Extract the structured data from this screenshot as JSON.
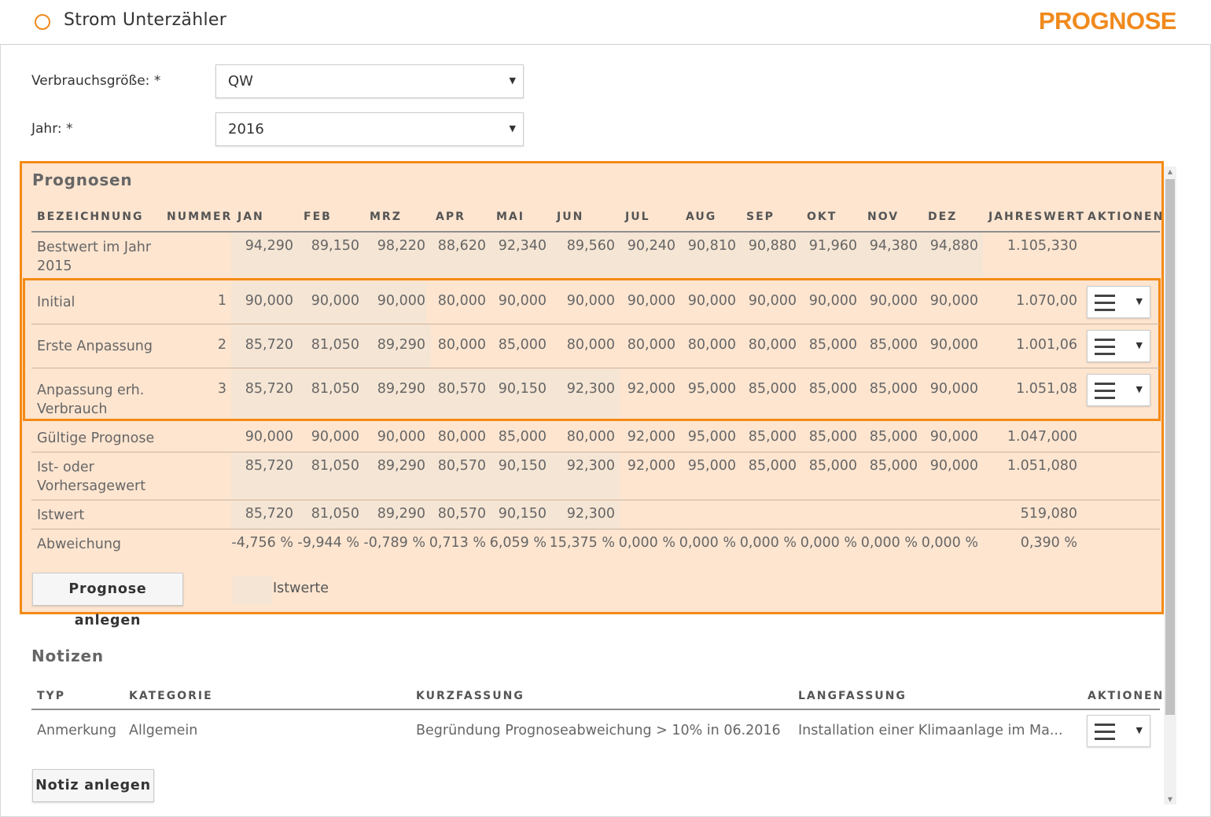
{
  "header": {
    "title": "Strom Unterzähler",
    "brand": "PROGNOSE"
  },
  "form": {
    "verbrauch_label": "Verbrauchsgröße: *",
    "verbrauch_value": "QW",
    "jahr_label": "Jahr: *",
    "jahr_value": "2016"
  },
  "prognosen": {
    "title": "Prognosen",
    "headers": [
      "BEZEICHNUNG",
      "NUMMER",
      "JAN",
      "FEB",
      "MRZ",
      "APR",
      "MAI",
      "JUN",
      "JUL",
      "AUG",
      "SEP",
      "OKT",
      "NOV",
      "DEZ",
      "JAHRESWERT",
      "AKTIONEN"
    ],
    "rows": [
      {
        "name": "Bestwert im Jahr 2015",
        "nummer": "",
        "values": [
          "94,290",
          "89,150",
          "98,220",
          "88,620",
          "92,340",
          "89,560",
          "90,240",
          "90,810",
          "90,880",
          "91,960",
          "94,380",
          "94,880"
        ],
        "jahr": "1.105,330"
      },
      {
        "name": "Initial",
        "nummer": "1",
        "values": [
          "90,000",
          "90,000",
          "90,000",
          "80,000",
          "90,000",
          "90,000",
          "90,000",
          "90,000",
          "90,000",
          "90,000",
          "90,000",
          "90,000"
        ],
        "jahr": "1.070,00"
      },
      {
        "name": "Erste Anpassung",
        "nummer": "2",
        "values": [
          "85,720",
          "81,050",
          "89,290",
          "80,000",
          "85,000",
          "80,000",
          "80,000",
          "80,000",
          "80,000",
          "85,000",
          "85,000",
          "90,000"
        ],
        "jahr": "1.001,06"
      },
      {
        "name": "Anpassung erh. Verbrauch",
        "nummer": "3",
        "values": [
          "85,720",
          "81,050",
          "89,290",
          "80,570",
          "90,150",
          "92,300",
          "92,000",
          "95,000",
          "85,000",
          "85,000",
          "85,000",
          "90,000"
        ],
        "jahr": "1.051,08"
      },
      {
        "name": "Gültige Prognose",
        "nummer": "",
        "values": [
          "90,000",
          "90,000",
          "90,000",
          "80,000",
          "85,000",
          "80,000",
          "92,000",
          "95,000",
          "85,000",
          "85,000",
          "85,000",
          "90,000"
        ],
        "jahr": "1.047,000"
      },
      {
        "name": "Ist- oder Vorhersagewert",
        "nummer": "",
        "values": [
          "85,720",
          "81,050",
          "89,290",
          "80,570",
          "90,150",
          "92,300",
          "92,000",
          "95,000",
          "85,000",
          "85,000",
          "85,000",
          "90,000"
        ],
        "jahr": "1.051,080"
      },
      {
        "name": "Istwert",
        "nummer": "",
        "values": [
          "85,720",
          "81,050",
          "89,290",
          "80,570",
          "90,150",
          "92,300",
          "",
          "",
          "",
          "",
          "",
          ""
        ],
        "jahr": "519,080"
      },
      {
        "name": "Abweichung",
        "nummer": "",
        "values": [
          "-4,756 %",
          "-9,944 %",
          "-0,789 %",
          "0,713 %",
          "6,059 %",
          "15,375 %",
          "0,000 %",
          "0,000 %",
          "0,000 %",
          "0,000 %",
          "0,000 %",
          "0,000 %"
        ],
        "jahr": "0,390 %"
      }
    ],
    "create_button": "Prognose anlegen",
    "legend_label": "Istwerte"
  },
  "notizen": {
    "title": "Notizen",
    "headers": [
      "TYP",
      "KATEGORIE",
      "KURZFASSUNG",
      "LANGFASSUNG",
      "AKTIONEN"
    ],
    "rows": [
      {
        "typ": "Anmerkung",
        "kategorie": "Allgemein",
        "kurz": "Begründung Prognoseabweichung > 10% in 06.2016",
        "lang": "Installation einer Klimaanlage im Ma..."
      }
    ],
    "create_button": "Notiz anlegen"
  },
  "icons": {
    "header": "circle-icon",
    "menu": "hamburger-icon",
    "dropdown": "chevron-down-icon"
  },
  "colors": {
    "accent": "#f08a1d",
    "highlight_bg": "#fde5d0",
    "istwert_bg": "#f5e5d4"
  }
}
